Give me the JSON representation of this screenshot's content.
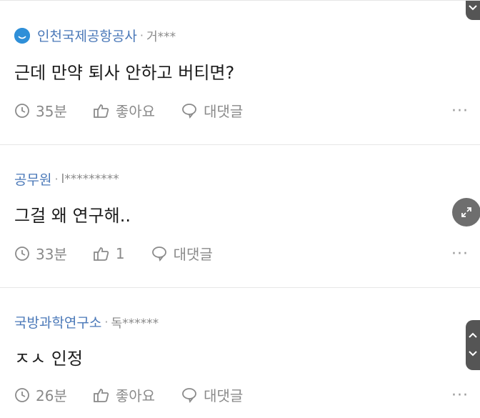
{
  "comments": [
    {
      "org": "인천국제공항공사",
      "user": "거***",
      "text": "근데 만약 퇴사 안하고 버티면?",
      "time": "35분",
      "like_label": "좋아요",
      "reply_label": "대댓글"
    },
    {
      "org": "공무원",
      "user": "l*********",
      "text": "그걸 왜 연구해..",
      "time": "33분",
      "like_label": "1",
      "reply_label": "대댓글"
    },
    {
      "org": "국방과학연구소",
      "user": "독******",
      "text": "ㅈㅅ 인정",
      "time": "26분",
      "like_label": "좋아요",
      "reply_label": "대댓글"
    }
  ],
  "separator": "·",
  "more_label": "···",
  "colors": {
    "org": "#4a78b8",
    "badge": "#2f8fd8",
    "muted": "#8a8a8a"
  }
}
